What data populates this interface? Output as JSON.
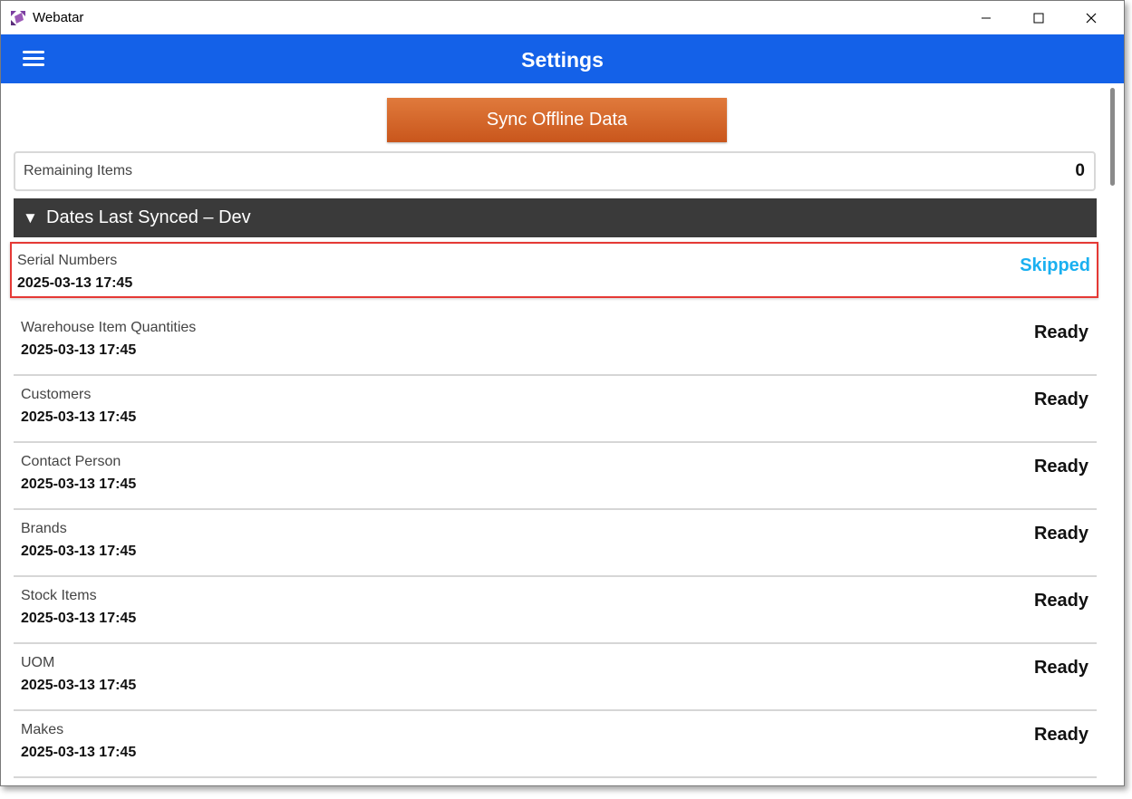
{
  "window": {
    "title": "Webatar"
  },
  "appbar": {
    "title": "Settings"
  },
  "sync_button": {
    "label": "Sync Offline Data"
  },
  "remaining": {
    "label": "Remaining Items",
    "value": "0"
  },
  "section": {
    "caret": "▼",
    "title": "Dates Last Synced – Dev"
  },
  "colors": {
    "appbar": "#1461e8",
    "sync_button": "#d0622a",
    "section_header": "#3a3a3a",
    "status_skipped": "#1ab0f0",
    "status_ready": "#111111",
    "highlight_border": "#e53935"
  },
  "icons": {
    "app": "webatar-logo-icon",
    "menu": "hamburger-menu-icon",
    "minimize": "minimize-icon",
    "maximize": "maximize-icon",
    "close": "close-icon"
  },
  "sync_items": [
    {
      "name": "Serial Numbers",
      "date": "2025-03-13 17:45",
      "status": "Skipped",
      "highlighted": true
    },
    {
      "name": "Warehouse Item Quantities",
      "date": "2025-03-13 17:45",
      "status": "Ready",
      "highlighted": false
    },
    {
      "name": "Customers",
      "date": "2025-03-13 17:45",
      "status": "Ready",
      "highlighted": false
    },
    {
      "name": "Contact Person",
      "date": "2025-03-13 17:45",
      "status": "Ready",
      "highlighted": false
    },
    {
      "name": "Brands",
      "date": "2025-03-13 17:45",
      "status": "Ready",
      "highlighted": false
    },
    {
      "name": "Stock Items",
      "date": "2025-03-13 17:45",
      "status": "Ready",
      "highlighted": false
    },
    {
      "name": "UOM",
      "date": "2025-03-13 17:45",
      "status": "Ready",
      "highlighted": false
    },
    {
      "name": "Makes",
      "date": "2025-03-13 17:45",
      "status": "Ready",
      "highlighted": false
    }
  ]
}
